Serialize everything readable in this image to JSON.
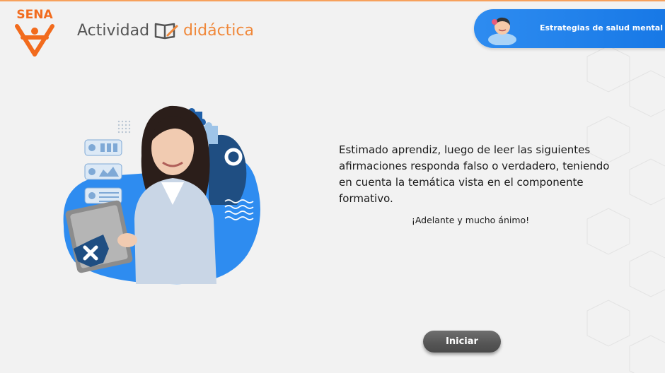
{
  "header": {
    "logo_text": "SENA",
    "activity_word1": "Actividad",
    "activity_word2": "didáctica",
    "topic": "Estrategias de salud mental"
  },
  "main": {
    "instructions": "Estimado aprendiz, luego de leer las siguientes afirmaciones responda falso o verdadero, teniendo en cuenta la temática vista en el componente formativo.",
    "encouragement": "¡Adelante y mucho ánimo!",
    "start_button": "Iniciar"
  },
  "colors": {
    "brand_orange": "#f26b1d",
    "accent_orange": "#f0883a",
    "badge_blue": "#1778e6",
    "button_gray": "#555555",
    "background": "#f2f2f2"
  },
  "icons": [
    "sena-logo-icon",
    "book-pencil-icon",
    "person-avatar-icon",
    "puzzle-icon",
    "close-icon"
  ]
}
